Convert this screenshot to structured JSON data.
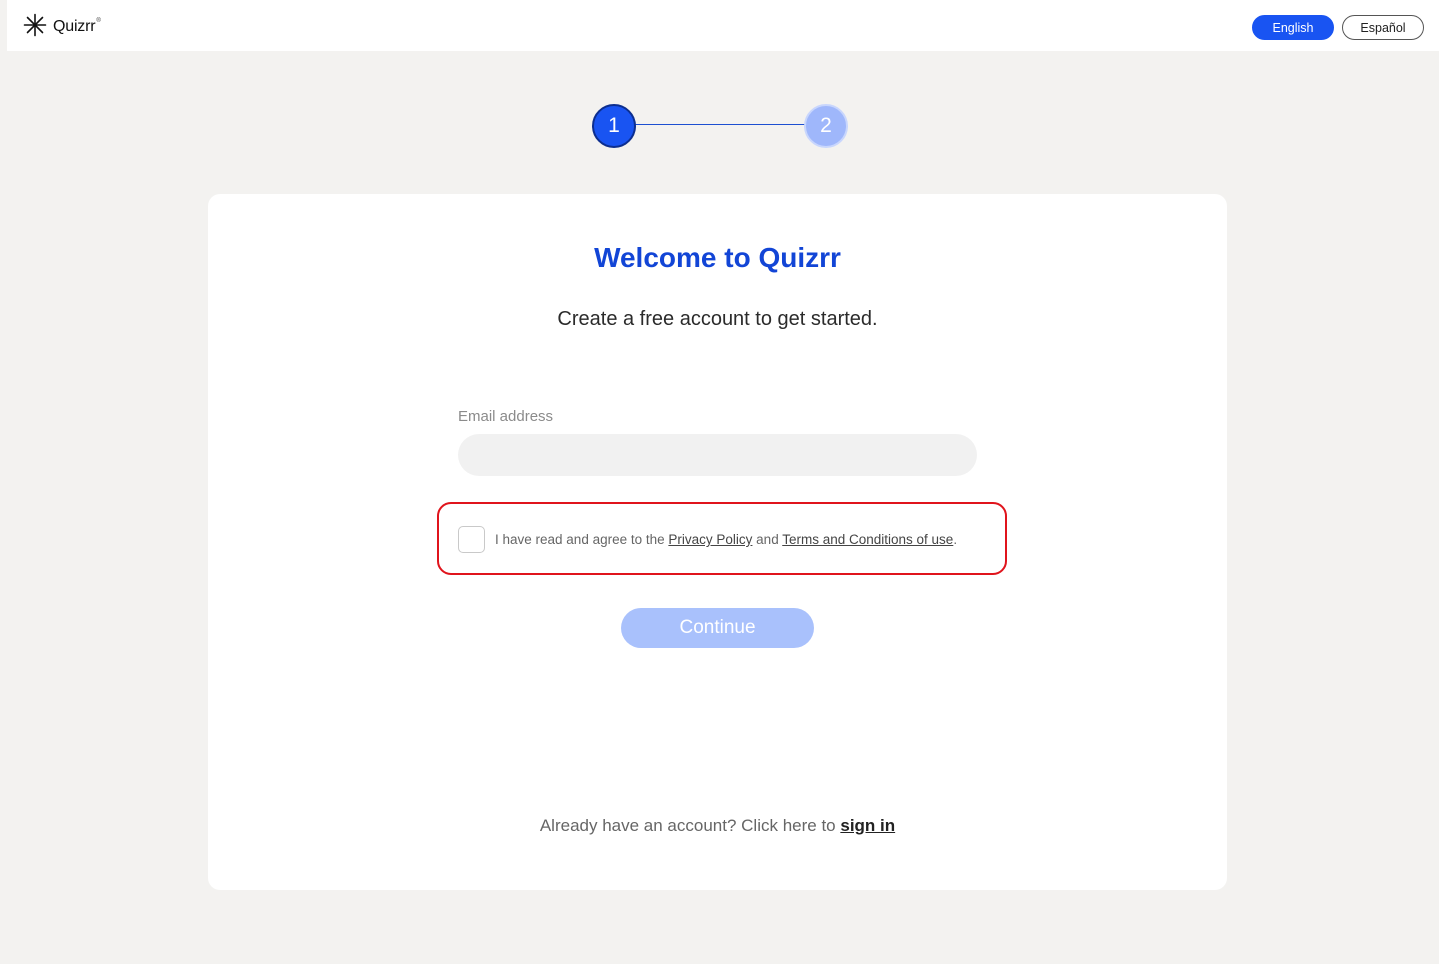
{
  "header": {
    "logo_text": "Quizrr",
    "logo_mark": "®",
    "languages": [
      {
        "label": "English",
        "selected": true
      },
      {
        "label": "Español",
        "selected": false
      }
    ]
  },
  "stepper": {
    "steps": [
      "1",
      "2"
    ],
    "current": 1
  },
  "card": {
    "title": "Welcome to Quizrr",
    "subtitle": "Create a free account to get started.",
    "email": {
      "label": "Email address",
      "value": "",
      "placeholder": ""
    },
    "consent": {
      "checked": false,
      "prefix": "I have read and agree to the ",
      "privacy_link": "Privacy Policy",
      "middle": " and ",
      "terms_link": "Terms and Conditions of use",
      "suffix": "."
    },
    "continue_label": "Continue",
    "signin": {
      "prefix": "Already have an account? Click here to ",
      "link": "sign in"
    }
  },
  "colors": {
    "accent": "#1954f2",
    "accent_disabled": "#a9c1fc",
    "title": "#1245d6",
    "highlight": "#e0141c",
    "background": "#f3f2f0"
  }
}
